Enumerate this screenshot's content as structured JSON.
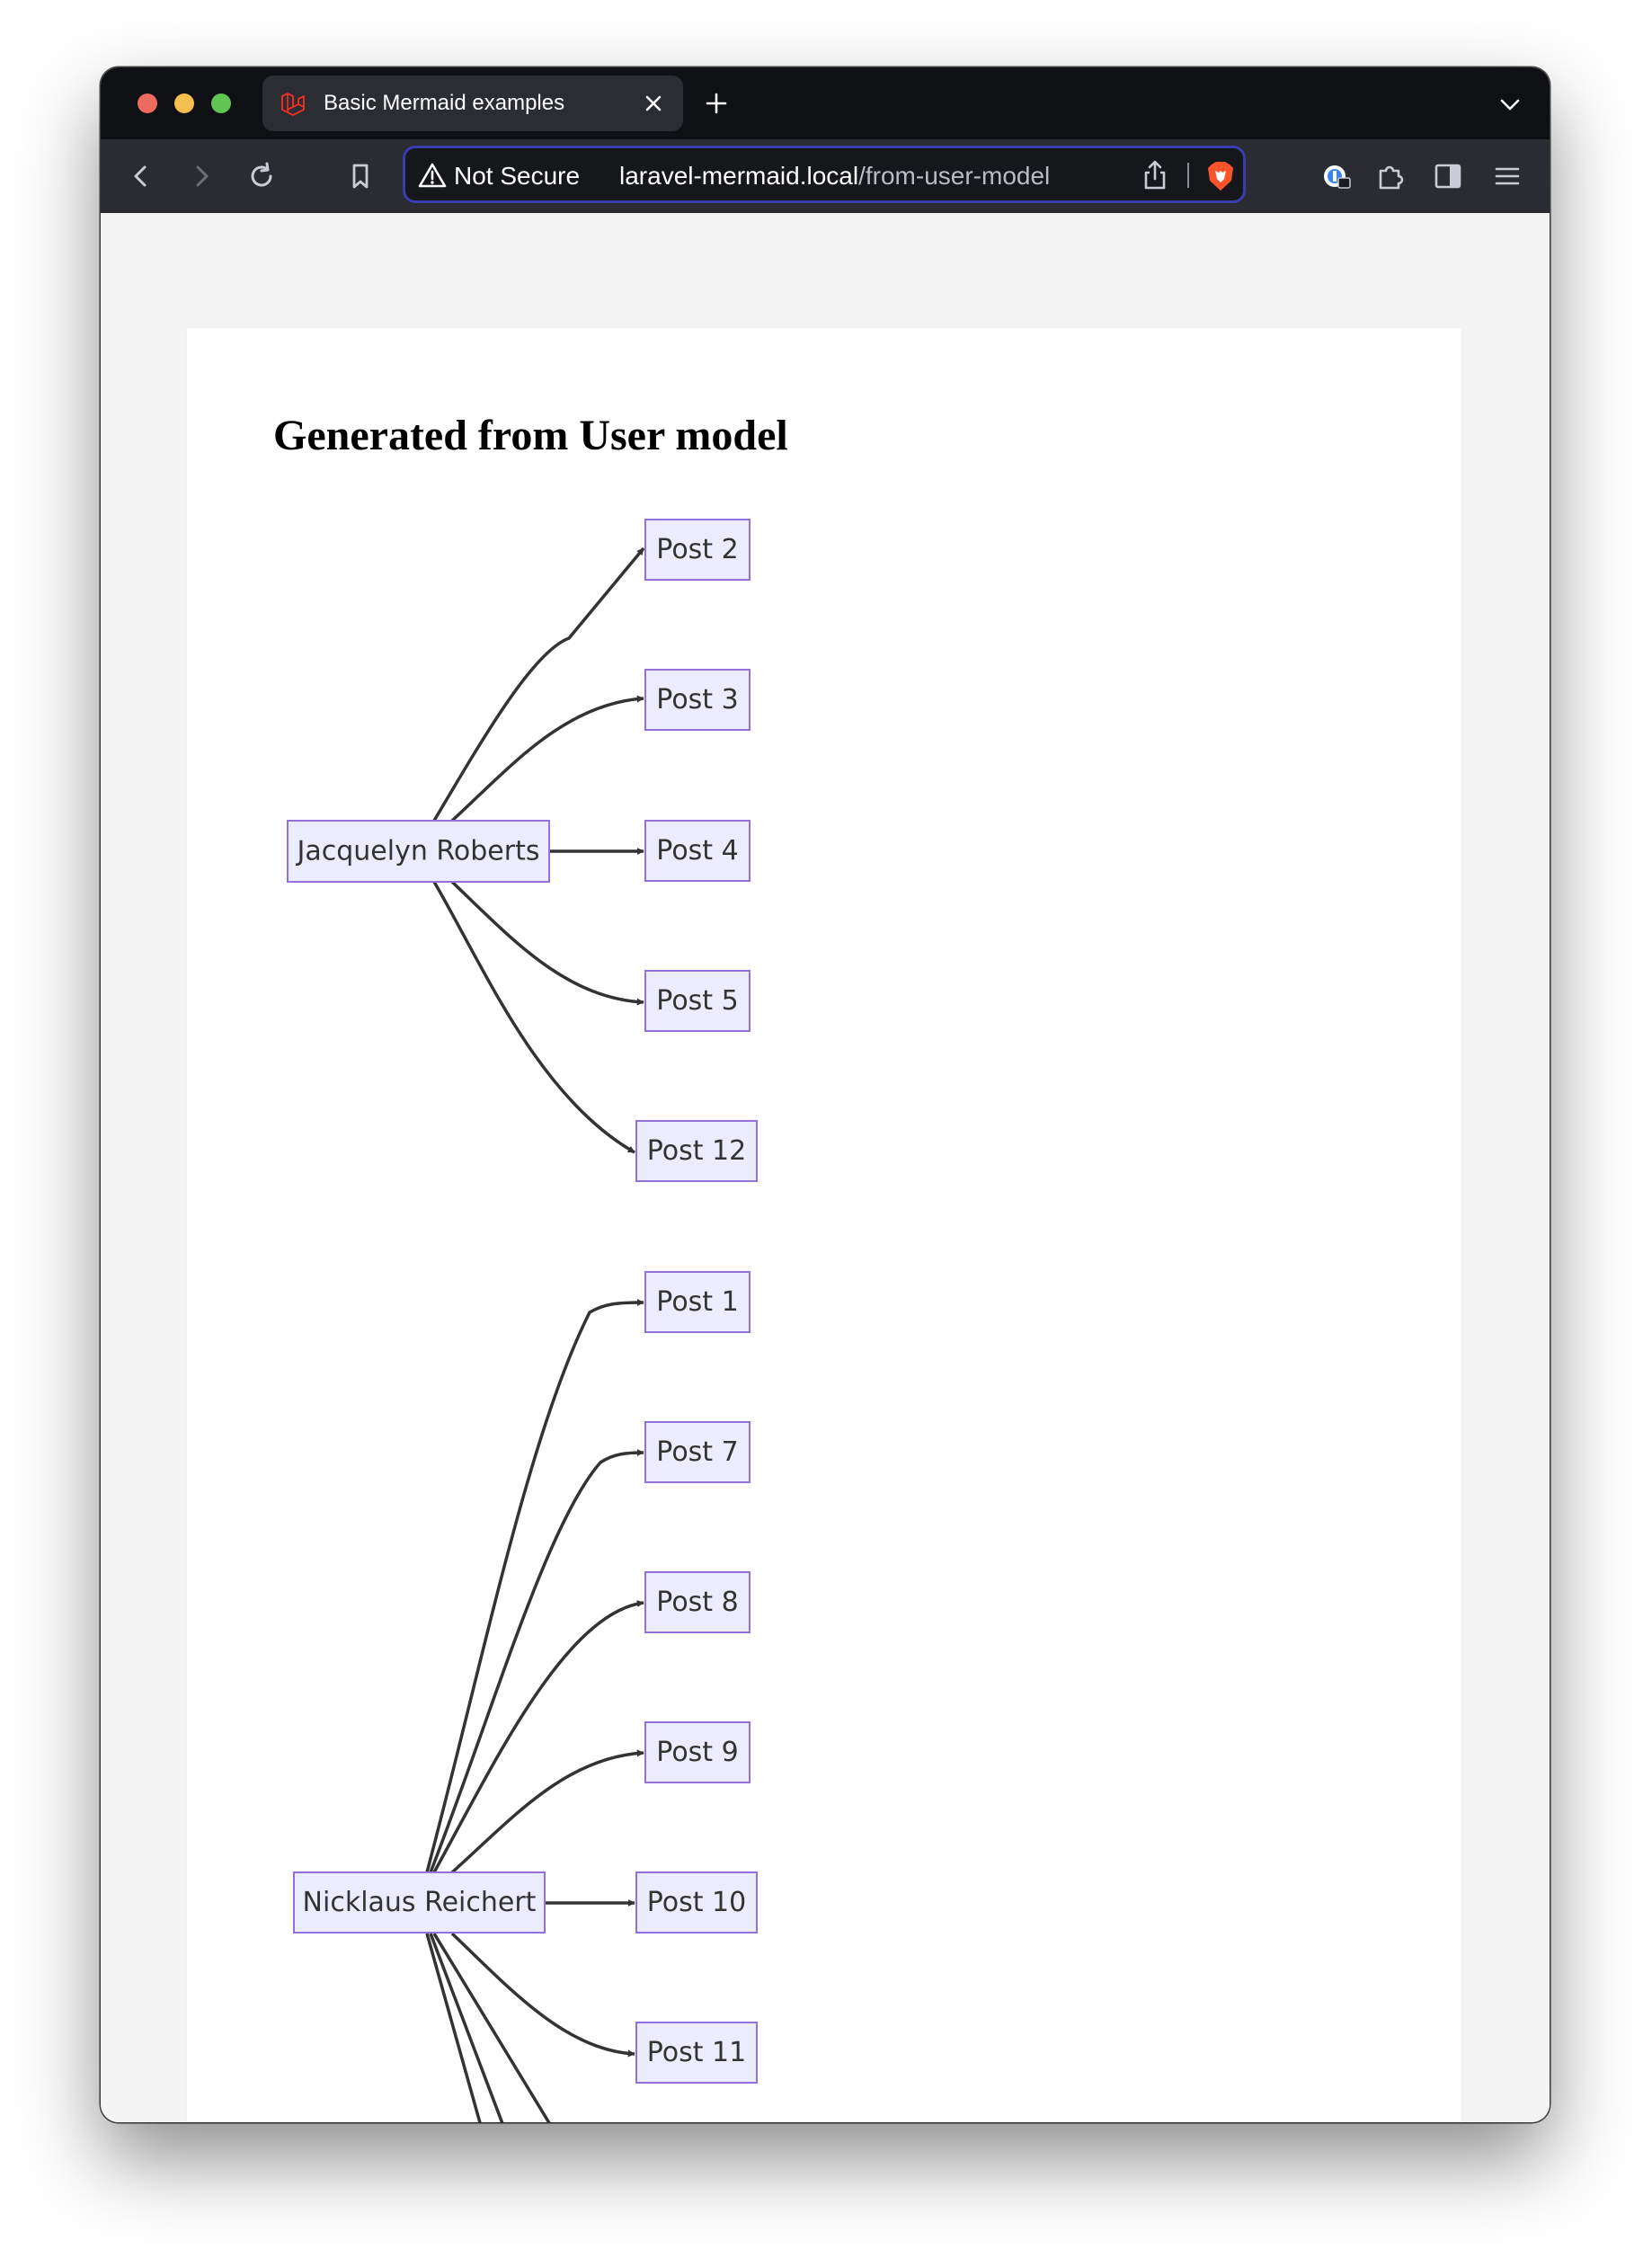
{
  "browser": {
    "tab": {
      "title": "Basic Mermaid examples",
      "favicon": "laravel-logo-icon"
    },
    "address_bar": {
      "security_label": "Not Secure",
      "url_host": "laravel-mermaid.local",
      "url_path": "/from-user-model"
    },
    "icons": [
      "back-icon",
      "forward-icon",
      "reload-icon",
      "bookmark-icon",
      "warning-icon",
      "share-icon",
      "brave-shields-icon",
      "password-manager-icon",
      "extensions-icon",
      "sidebar-icon",
      "menu-icon",
      "close-icon",
      "plus-icon",
      "chevron-down-icon"
    ]
  },
  "page": {
    "heading": "Generated from User model"
  },
  "diagram": {
    "type": "flowchart LR",
    "colors": {
      "node_fill": "#ececff",
      "node_border": "#9370db",
      "edge": "#333333",
      "text": "#333333"
    },
    "nodes": [
      {
        "id": "u1",
        "label": "Jacquelyn Roberts"
      },
      {
        "id": "p2",
        "label": "Post 2"
      },
      {
        "id": "p3",
        "label": "Post 3"
      },
      {
        "id": "p4",
        "label": "Post 4"
      },
      {
        "id": "p5",
        "label": "Post 5"
      },
      {
        "id": "p12",
        "label": "Post 12"
      },
      {
        "id": "u2",
        "label": "Nicklaus Reichert"
      },
      {
        "id": "p1",
        "label": "Post 1"
      },
      {
        "id": "p7",
        "label": "Post 7"
      },
      {
        "id": "p8",
        "label": "Post 8"
      },
      {
        "id": "p9",
        "label": "Post 9"
      },
      {
        "id": "p10",
        "label": "Post 10"
      },
      {
        "id": "p11",
        "label": "Post 11"
      }
    ],
    "edges": [
      {
        "from": "u1",
        "to": "p2"
      },
      {
        "from": "u1",
        "to": "p3"
      },
      {
        "from": "u1",
        "to": "p4"
      },
      {
        "from": "u1",
        "to": "p5"
      },
      {
        "from": "u1",
        "to": "p12"
      },
      {
        "from": "u2",
        "to": "p1"
      },
      {
        "from": "u2",
        "to": "p7"
      },
      {
        "from": "u2",
        "to": "p8"
      },
      {
        "from": "u2",
        "to": "p9"
      },
      {
        "from": "u2",
        "to": "p10"
      },
      {
        "from": "u2",
        "to": "p11"
      }
    ]
  }
}
